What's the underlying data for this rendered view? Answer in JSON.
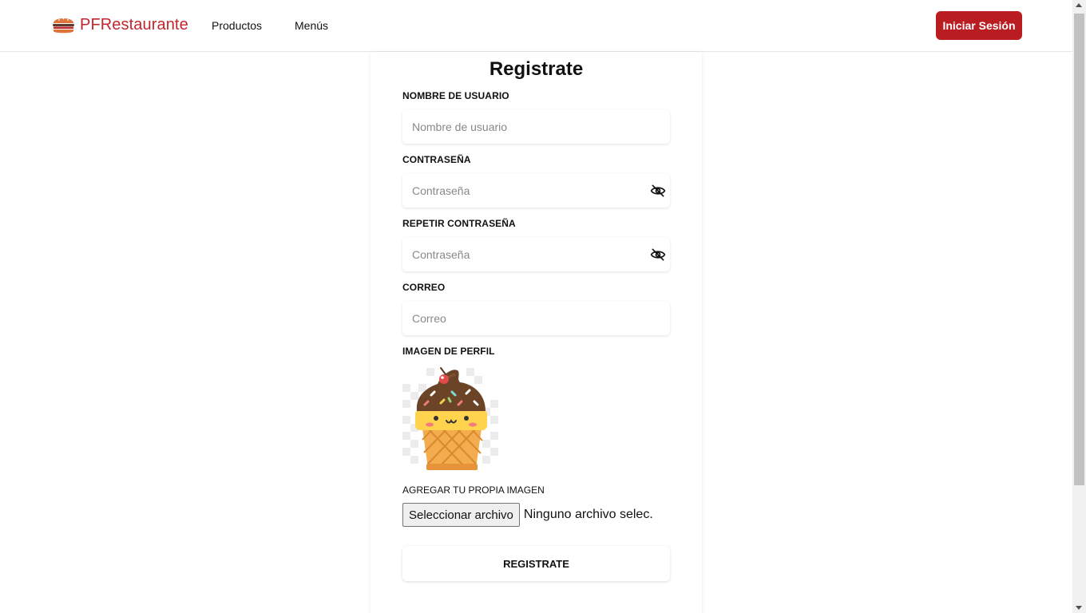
{
  "app": {
    "brand": "PFRestaurante",
    "brand_icon": "burger-icon",
    "accent_color": "#b91c21"
  },
  "nav": {
    "links": [
      "Productos",
      "Menús"
    ],
    "login_label": "Iniciar Sesión"
  },
  "form": {
    "title": "Registrate",
    "username": {
      "label": "NOMBRE DE USUARIO",
      "placeholder": "Nombre de usuario",
      "value": ""
    },
    "password": {
      "label": "CONTRASEÑA",
      "placeholder": "Contraseña",
      "value": "",
      "icon": "eye-off-icon"
    },
    "repeat_password": {
      "label": "REPETIR CONTRASEÑA",
      "placeholder": "Contraseña",
      "value": "",
      "icon": "eye-off-icon"
    },
    "email": {
      "label": "CORREO",
      "placeholder": "Correo",
      "value": ""
    },
    "profile_image": {
      "label": "IMAGEN DE PERFIL",
      "avatar_icon": "ice-cream-cone-icon",
      "upload_label": "AGREGAR TU PROPIA IMAGEN",
      "file_button": "Seleccionar archivo",
      "file_status": "Ninguno archivo selec."
    },
    "submit_label": "REGISTRATE"
  }
}
